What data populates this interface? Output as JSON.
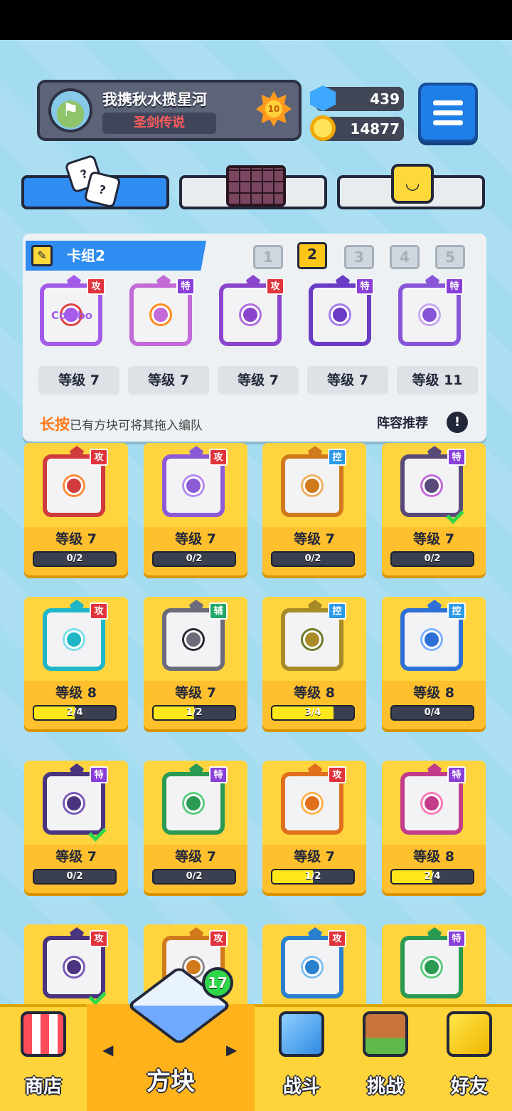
{
  "player": {
    "name": "我携秋水揽星河",
    "title": "圣剑传说",
    "rank": "10"
  },
  "currency": {
    "gems": "439",
    "coins": "14877"
  },
  "deck": {
    "label": "卡组2",
    "numbers": [
      "1",
      "2",
      "3",
      "4",
      "5"
    ],
    "active_number": "2",
    "cards": [
      {
        "tag": "攻",
        "level": "等级 7",
        "text": "Combo",
        "color": "#a35be8",
        "color2": "#e04040"
      },
      {
        "tag": "特",
        "level": "等级 7",
        "text": "",
        "color": "#c26bd6",
        "color2": "#ff8c1a"
      },
      {
        "tag": "攻",
        "level": "等级 7",
        "text": "",
        "color": "#8a45cc",
        "color2": "#b06fe0"
      },
      {
        "tag": "特",
        "level": "等级 7",
        "text": "",
        "color": "#6a3bc4",
        "color2": "#a67de8"
      },
      {
        "tag": "特",
        "level": "等级 11",
        "text": "",
        "color": "#8855d8",
        "color2": "#c8a8f0"
      }
    ],
    "hint_highlight": "长按",
    "hint_rest": "已有方块可将其拖入编队",
    "lineup_link": "阵容推荐",
    "info_glyph": "!"
  },
  "collection": [
    {
      "tag": "攻",
      "level": "等级 7",
      "progress": "0/2",
      "fill": 0.0,
      "color": "#d03c3c",
      "color2": "#ff8a3a",
      "checked": false
    },
    {
      "tag": "攻",
      "level": "等级 7",
      "progress": "0/2",
      "fill": 0.0,
      "color": "#8d5ad6",
      "color2": "#b58cf0",
      "checked": false
    },
    {
      "tag": "控",
      "level": "等级 7",
      "progress": "0/2",
      "fill": 0.0,
      "color": "#d07a1c",
      "color2": "#f0b060",
      "checked": false
    },
    {
      "tag": "特",
      "level": "等级 7",
      "progress": "0/2",
      "fill": 0.0,
      "color": "#5a4a7a",
      "color2": "#c26bd6",
      "checked": true
    },
    {
      "tag": "攻",
      "level": "等级 8",
      "progress": "2/4",
      "fill": 0.5,
      "color": "#1fb6c8",
      "color2": "#7ee0ea",
      "checked": false
    },
    {
      "tag": "辅",
      "level": "等级 7",
      "progress": "1/2",
      "fill": 0.5,
      "color": "#6b6b7a",
      "color2": "#2a2a33",
      "checked": false
    },
    {
      "tag": "控",
      "level": "等级 8",
      "progress": "3/4",
      "fill": 0.75,
      "color": "#a88a28",
      "color2": "#6c7a2a",
      "checked": false
    },
    {
      "tag": "控",
      "level": "等级 8",
      "progress": "0/4",
      "fill": 0.0,
      "color": "#2e6fd6",
      "color2": "#7fb2ff",
      "checked": false
    },
    {
      "tag": "特",
      "level": "等级 7",
      "progress": "0/2",
      "fill": 0.0,
      "color": "#4a3480",
      "color2": "#7a5ab8",
      "checked": true
    },
    {
      "tag": "特",
      "level": "等级 7",
      "progress": "0/2",
      "fill": 0.0,
      "color": "#2a9a52",
      "color2": "#5ccc7e",
      "checked": false
    },
    {
      "tag": "攻",
      "level": "等级 7",
      "progress": "1/2",
      "fill": 0.5,
      "color": "#e0701c",
      "color2": "#ffb24a",
      "checked": false
    },
    {
      "tag": "特",
      "level": "等级 8",
      "progress": "2/4",
      "fill": 0.5,
      "color": "#c23c8a",
      "color2": "#ff7ab8",
      "checked": false
    },
    {
      "tag": "攻",
      "level": "",
      "progress": "",
      "fill": 0.0,
      "color": "#4a3480",
      "color2": "#7a5ab8",
      "checked": true
    },
    {
      "tag": "攻",
      "level": "",
      "progress": "",
      "fill": 0.0,
      "color": "#d07a1c",
      "color2": "#888888",
      "checked": false
    },
    {
      "tag": "攻",
      "level": "",
      "progress": "",
      "fill": 0.0,
      "color": "#2a7fcf",
      "color2": "#7ec0f0",
      "checked": false
    },
    {
      "tag": "特",
      "level": "",
      "progress": "",
      "fill": 0.0,
      "color": "#2a9a52",
      "color2": "#5ccc7e",
      "checked": false
    }
  ],
  "tag_colors": {
    "攻": "#e0333c",
    "特": "#8a3fd8",
    "控": "#2b9ae8",
    "辅": "#20a86a"
  },
  "bottom_nav": {
    "shop": "商店",
    "cubes": "方块",
    "battle": "战斗",
    "challenge": "挑战",
    "friends": "好友",
    "cube_badge": "17",
    "arrow_left": "◀",
    "arrow_right": "▶"
  },
  "icons": {
    "avatar": "flag-avatar-icon",
    "rank": "rank-star-icon",
    "gem": "gem-icon",
    "coin": "coin-icon",
    "menu": "hamburger-icon",
    "dice": "dice-icon",
    "grid": "board-grid-icon",
    "smile": "smile-cube-icon",
    "pencil": "pencil-icon",
    "info": "info-icon",
    "check": "check-icon"
  }
}
